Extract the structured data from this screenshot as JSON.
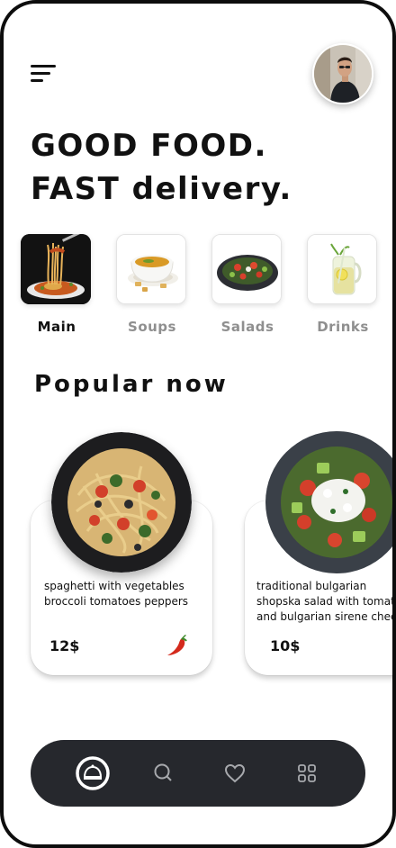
{
  "header": {
    "title_line1": "GOOD FOOD.",
    "title_line2": "FAST delivery."
  },
  "categories": [
    {
      "label": "Main",
      "active": true,
      "icon": "spaghetti-fork-image"
    },
    {
      "label": "Soups",
      "active": false,
      "icon": "soup-bowl-image"
    },
    {
      "label": "Salads",
      "active": false,
      "icon": "salad-plate-image"
    },
    {
      "label": "Drinks",
      "active": false,
      "icon": "lemonade-jar-image"
    }
  ],
  "popular": {
    "title": "Popular now",
    "items": [
      {
        "desc_line1": "spaghetti with vegetables",
        "desc_line2": "broccoli tomatoes peppers",
        "price": "12$",
        "badge_icon": "chili-pepper-icon"
      },
      {
        "desc_line1": "traditional bulgarian",
        "desc_line2": "shopska salad with tomatoes",
        "desc_line3": "and bulgarian sirene cheese",
        "price": "10$"
      }
    ]
  },
  "bottom_nav": {
    "items": [
      "home-cloche-icon",
      "search-icon",
      "heart-icon",
      "grid-icon"
    ],
    "active": "home-cloche-icon"
  },
  "colors": {
    "nav_background": "#26282d",
    "text": "#111111",
    "inactive_label": "#8f8f8f",
    "nav_icon": "#a7a9ad"
  }
}
